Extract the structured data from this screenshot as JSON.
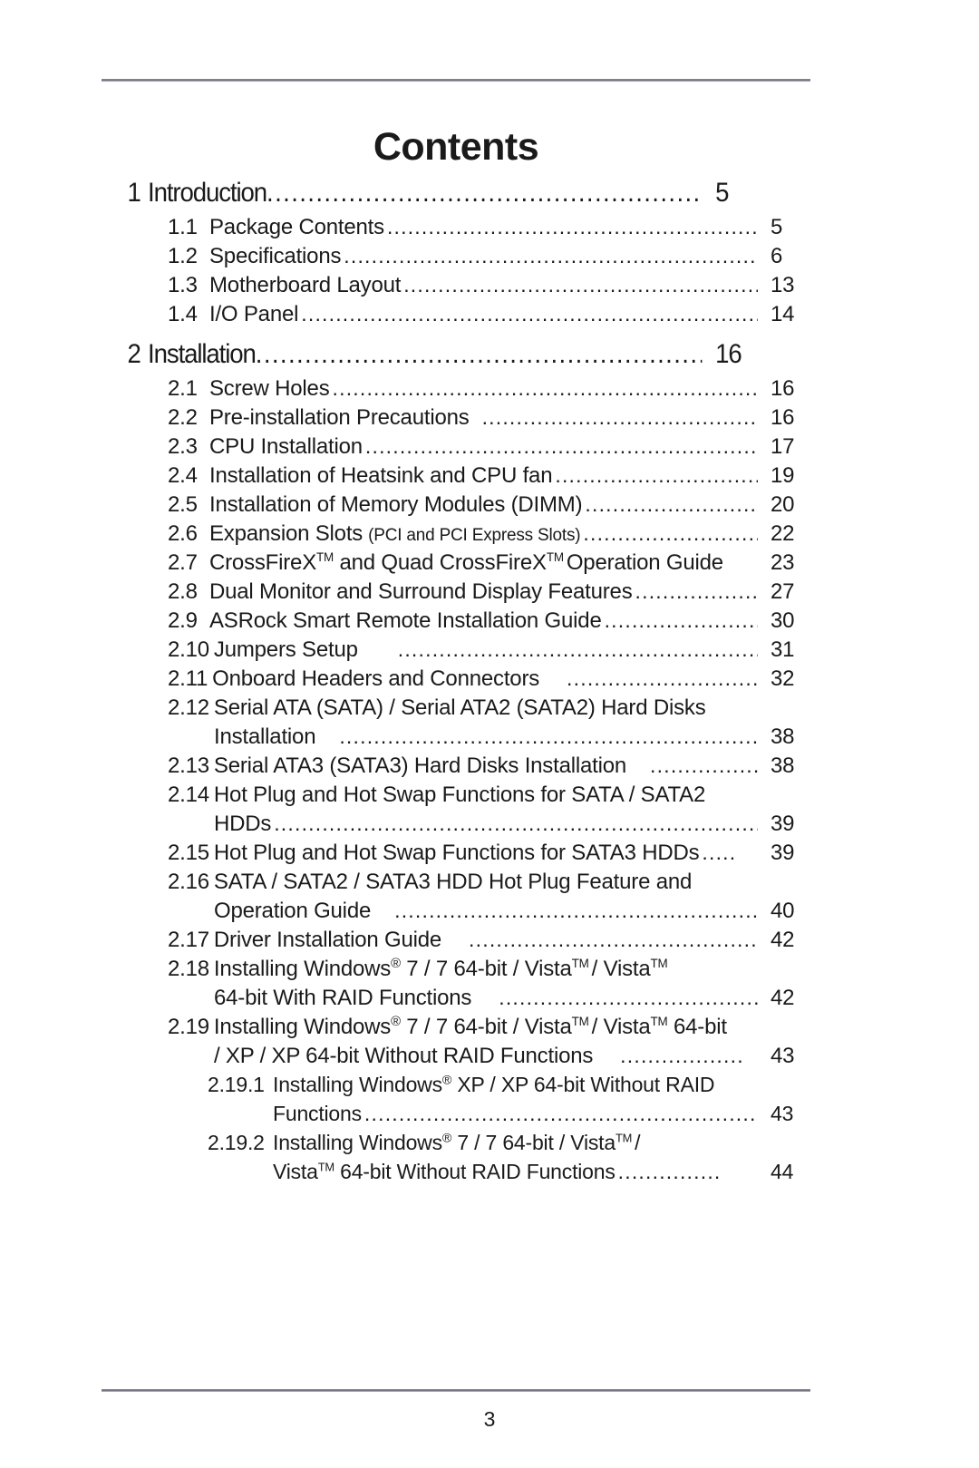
{
  "document": {
    "title": "Contents",
    "page_number": "3"
  },
  "toc": {
    "chapters": [
      {
        "num": "1",
        "label": "Introduction",
        "page": "5"
      },
      {
        "num": "2",
        "label": "Installation",
        "page": "16"
      }
    ],
    "entries": [
      {
        "num": "1.1",
        "label": "Package Contents",
        "page": "5"
      },
      {
        "num": "1.2",
        "label": "Specifications",
        "page": "6"
      },
      {
        "num": "1.3",
        "label": "Motherboard Layout",
        "page": "13"
      },
      {
        "num": "1.4",
        "label": "I/O Panel",
        "page": "14"
      },
      {
        "num": "2.1",
        "label": "Screw Holes",
        "page": "16"
      },
      {
        "num": "2.2",
        "label": "Pre-installation Precautions",
        "page": "16"
      },
      {
        "num": "2.3",
        "label": "CPU Installation",
        "page": "17"
      },
      {
        "num": "2.4",
        "label": "Installation of Heatsink and CPU fan",
        "page": "19"
      },
      {
        "num": "2.5",
        "label": "Installation of Memory Modules (DIMM)",
        "page": "20"
      },
      {
        "num": "2.6",
        "label": "Expansion Slots",
        "label_small": "(PCI and PCI Express Slots)",
        "page": "22"
      },
      {
        "num": "2.7",
        "label": "CrossFireX",
        "label_sup": "TM",
        "label_mid": " and Quad CrossFireX",
        "label_sup2": "TM",
        "label_end": "Operation Guide",
        "page": "23"
      },
      {
        "num": "2.8",
        "label": "Dual Monitor and Surround Display Features",
        "page": "27"
      },
      {
        "num": "2.9",
        "label": "ASRock Smart Remote Installation Guide",
        "page": "30"
      },
      {
        "num": "2.10",
        "label": "Jumpers Setup",
        "page": "31"
      },
      {
        "num": "2.11",
        "label": "Onboard Headers and Connectors",
        "page": "32"
      },
      {
        "num": "2.12",
        "label": "Serial ATA (SATA) / Serial ATA2 (SATA2) Hard Disks",
        "cont": "Installation",
        "page": "38"
      },
      {
        "num": "2.13",
        "label": "Serial ATA3 (SATA3) Hard Disks Installation",
        "page": "38"
      },
      {
        "num": "2.14",
        "label": "Hot Plug and Hot Swap Functions for SATA / SATA2",
        "cont": "HDDs",
        "page": "39"
      },
      {
        "num": "2.15",
        "label": "Hot Plug and Hot Swap Functions for SATA3 HDDs",
        "page": "39"
      },
      {
        "num": "2.16",
        "label": "SATA / SATA2 / SATA3 HDD Hot Plug Feature and",
        "cont": "Operation Guide",
        "page": "40"
      },
      {
        "num": "2.17",
        "label": "Driver Installation Guide",
        "page": "42"
      },
      {
        "num": "2.18",
        "label": "Installing Windows",
        "cont": "64-bit With RAID Functions",
        "page": "42"
      },
      {
        "num": "2.19",
        "label": "Installing Windows",
        "cont": "/ XP / XP 64-bit Without RAID Functions",
        "page": "43"
      },
      {
        "num": "2.19.1",
        "label": "Installing Windows",
        "cont": "Functions",
        "page": "43"
      },
      {
        "num": "2.19.2",
        "label": "Installing Windows",
        "cont": "Vista",
        "page": "44"
      }
    ],
    "line_2_18": {
      "num": "2.18",
      "prefix": "Installing Windows",
      "reg": "®",
      "mid": " 7 / 7 64-bit / Vista",
      "tm1": "TM",
      "mid2": "/ Vista",
      "tm2": "TM",
      "cont": "64-bit With RAID Functions",
      "page": "42"
    },
    "line_2_19": {
      "num": "2.19",
      "prefix": "Installing Windows",
      "reg": "®",
      "mid": " 7 / 7 64-bit / Vista",
      "tm1": "TM",
      "mid2": "/ Vista",
      "tm2": "TM",
      "tail": " 64-bit",
      "cont": "/ XP / XP 64-bit Without RAID Functions",
      "page": "43"
    },
    "line_2_19_1": {
      "num": "2.19.1",
      "prefix": "Installing Windows",
      "reg": "®",
      "mid": " XP / XP 64-bit Without RAID",
      "cont": "Functions",
      "page": "43"
    },
    "line_2_19_2": {
      "num": "2.19.2",
      "prefix": "Installing Windows",
      "reg": "®",
      "mid": " 7 / 7 64-bit / Vista",
      "tm1": "TM",
      "mid2": "/",
      "cont_prefix": "Vista",
      "cont_tm": "TM",
      "cont_rest": " 64-bit Without RAID Functions",
      "page": "44"
    },
    "leader_char": "."
  }
}
